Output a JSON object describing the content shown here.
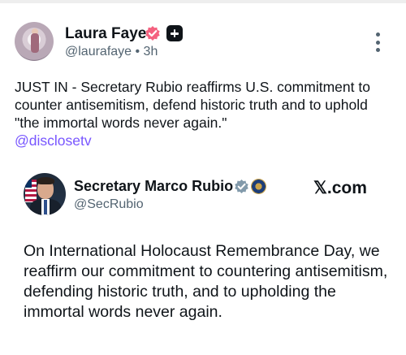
{
  "post": {
    "author_name": "Laura Faye",
    "handle_time": "@laurafaye • 3h",
    "text": "JUST IN - Secretary Rubio reaffirms U.S. commitment to counter antisemitism, defend historic truth and to uphold \"the immortal words never again.\"",
    "mention": "@disclosetv",
    "icons": [
      "verified-badge-icon",
      "plus-badge-icon",
      "more-options-icon"
    ],
    "colors": {
      "verified": "#f4617f",
      "mention": "#7856ff"
    }
  },
  "quote": {
    "author_name": "Secretary Marco Rubio",
    "handle": "@SecRubio",
    "source": "𝕏.com",
    "text": "On International Holocaust Remembrance Day, we reaffirm our commitment to countering antisemitism, defending historic truth, and to upholding the immortal words never again.",
    "icons": [
      "gray-verified-icon",
      "state-dept-seal-icon"
    ],
    "colors": {
      "gray_check": "#829aab"
    }
  }
}
